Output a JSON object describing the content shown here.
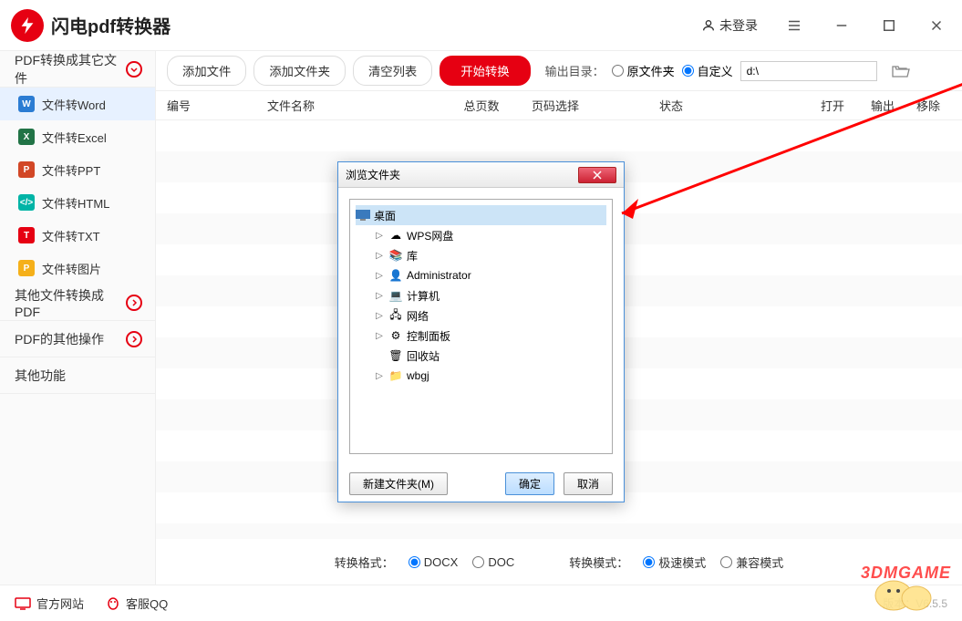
{
  "app": {
    "title": "闪电pdf转换器",
    "login": "未登录"
  },
  "sidebar": {
    "cat1": "PDF转换成其它文件",
    "items": [
      "文件转Word",
      "文件转Excel",
      "文件转PPT",
      "文件转HTML",
      "文件转TXT",
      "文件转图片"
    ],
    "cat2": "其他文件转换成PDF",
    "cat3": "PDF的其他操作",
    "cat4": "其他功能"
  },
  "toolbar": {
    "add_file": "添加文件",
    "add_folder": "添加文件夹",
    "clear": "清空列表",
    "start": "开始转换",
    "out_label": "输出目录：",
    "src_radio": "原文件夹",
    "custom_radio": "自定义",
    "path": "d:\\"
  },
  "table": {
    "num": "编号",
    "name": "文件名称",
    "pages": "总页数",
    "range": "页码选择",
    "status": "状态",
    "open": "打开",
    "out": "输出",
    "del": "移除"
  },
  "bottom": {
    "fmt_label": "转换格式：",
    "docx": "DOCX",
    "doc": "DOC",
    "mode_label": "转换模式：",
    "fast": "极速模式",
    "compat": "兼容模式"
  },
  "footer": {
    "site": "官方网站",
    "qq": "客服QQ",
    "version": "版本：V6.5.5"
  },
  "dialog": {
    "title": "浏览文件夹",
    "desktop": "桌面",
    "items": [
      "WPS网盘",
      "库",
      "Administrator",
      "计算机",
      "网络",
      "控制面板",
      "回收站",
      "wbgj"
    ],
    "new_folder": "新建文件夹(M)",
    "ok": "确定",
    "cancel": "取消"
  },
  "watermark": "3DMGAME"
}
